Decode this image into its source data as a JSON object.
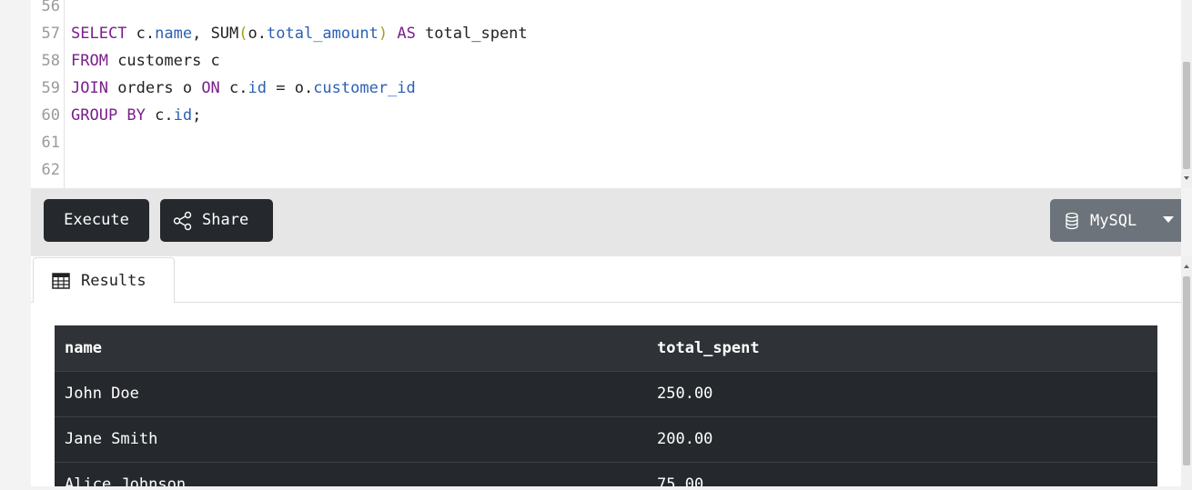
{
  "editor": {
    "line_numbers": [
      "56",
      "57",
      "58",
      "59",
      "60",
      "61",
      "62"
    ],
    "lines": [
      [],
      [
        {
          "t": "SELECT",
          "c": "kw"
        },
        {
          "t": " c.",
          "c": ""
        },
        {
          "t": "name",
          "c": "prop"
        },
        {
          "t": ", SUM",
          "c": ""
        },
        {
          "t": "(",
          "c": "paren"
        },
        {
          "t": "o.",
          "c": ""
        },
        {
          "t": "total_amount",
          "c": "prop"
        },
        {
          "t": ")",
          "c": "paren"
        },
        {
          "t": " ",
          "c": ""
        },
        {
          "t": "AS",
          "c": "kw"
        },
        {
          "t": " total_spent",
          "c": ""
        }
      ],
      [
        {
          "t": "FROM",
          "c": "kw"
        },
        {
          "t": " customers c",
          "c": ""
        }
      ],
      [
        {
          "t": "JOIN",
          "c": "kw"
        },
        {
          "t": " orders o ",
          "c": ""
        },
        {
          "t": "ON",
          "c": "kw"
        },
        {
          "t": " c.",
          "c": ""
        },
        {
          "t": "id",
          "c": "prop"
        },
        {
          "t": " = o.",
          "c": ""
        },
        {
          "t": "customer_id",
          "c": "prop"
        }
      ],
      [
        {
          "t": "GROUP BY",
          "c": "kw"
        },
        {
          "t": " c.",
          "c": ""
        },
        {
          "t": "id",
          "c": "prop"
        },
        {
          "t": ";",
          "c": ""
        }
      ],
      [],
      []
    ]
  },
  "toolbar": {
    "execute_label": "Execute",
    "share_label": "Share",
    "share_icon": "share-icon",
    "database": {
      "selected": "MySQL",
      "icon": "database-icon"
    }
  },
  "results": {
    "tab_label": "Results",
    "tab_icon": "table-icon",
    "columns": [
      "name",
      "total_spent"
    ],
    "rows": [
      [
        "John Doe",
        "250.00"
      ],
      [
        "Jane Smith",
        "200.00"
      ],
      [
        "Alice Johnson",
        "75.00"
      ]
    ]
  },
  "colors": {
    "keyword": "#7a1f8c",
    "property": "#2c5fb3",
    "paren": "#a0a020",
    "button_dark": "#25282c",
    "select_gray": "#6c737a",
    "table_header": "#2f3237",
    "table_row": "#25282c"
  }
}
